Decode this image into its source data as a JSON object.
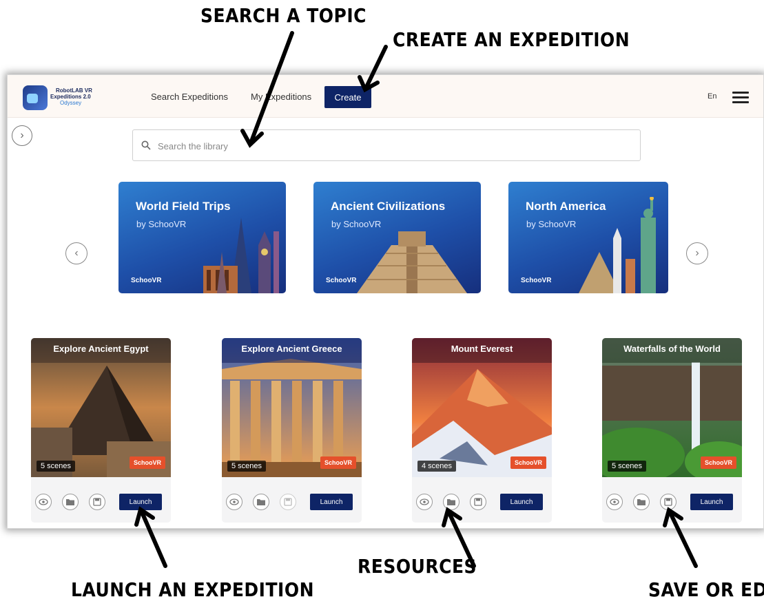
{
  "callouts": {
    "search": "SEARCH A TOPIC",
    "create": "CREATE AN EXPEDITION",
    "resources": "RESOURCES",
    "launch": "LAUNCH AN EXPEDITION",
    "save": "SAVE OR EDIT"
  },
  "header": {
    "logo_line1": "RobotLAB VR",
    "logo_line2": "Expeditions 2.0",
    "logo_line3": "Odyssey",
    "nav": [
      "Search Expeditions",
      "My Expeditions"
    ],
    "create_label": "Create",
    "language": "En",
    "menu_icon": "hamburger-icon"
  },
  "search": {
    "placeholder": "Search the library",
    "icon": "search-icon"
  },
  "featured": [
    {
      "title": "World Field Trips",
      "byline": "by SchooVR",
      "brand": "SchooVR"
    },
    {
      "title": "Ancient Civilizations",
      "byline": "by SchooVR",
      "brand": "SchooVR"
    },
    {
      "title": "North America",
      "byline": "by SchooVR",
      "brand": "SchooVR"
    }
  ],
  "expeditions": [
    {
      "title": "Explore Ancient Egypt",
      "scenes": "5 scenes",
      "tag": "SchooVR",
      "launch": "Launch"
    },
    {
      "title": "Explore Ancient Greece",
      "scenes": "5 scenes",
      "tag": "SchooVR",
      "launch": "Launch"
    },
    {
      "title": "Mount Everest",
      "scenes": "4 scenes",
      "tag": "SchooVR",
      "launch": "Launch"
    },
    {
      "title": "Waterfalls of the World",
      "scenes": "5 scenes",
      "tag": "SchooVR",
      "launch": "Launch"
    }
  ],
  "colors": {
    "primary": "#0e2466",
    "tag": "#e5502b",
    "feature": "#1e4fa8"
  }
}
